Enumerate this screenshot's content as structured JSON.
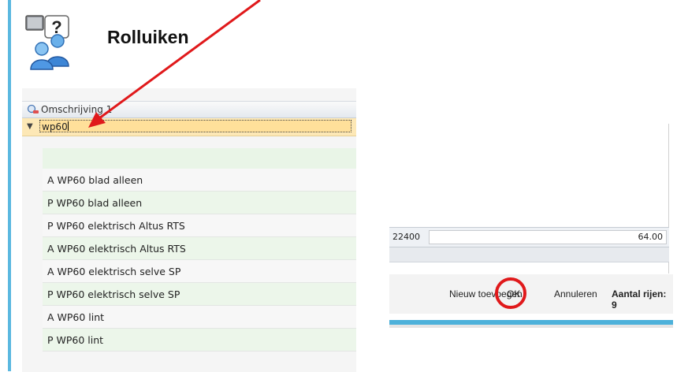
{
  "header": {
    "title": "Rolluiken",
    "icon": "people-help-icon"
  },
  "grid": {
    "column_header": "Omschrijving 1",
    "filter_value": "wp60",
    "items": [
      "A WP60 blad alleen",
      "P WP60 blad alleen",
      "P WP60 elektrisch Altus RTS",
      "A WP60 elektrisch Altus RTS",
      "A WP60 elektrisch selve SP",
      "P WP60 elektrisch selve SP",
      "A WP60 lint",
      "P WP60 lint"
    ]
  },
  "detail": {
    "code": "22400",
    "amount": "64.00"
  },
  "footer": {
    "new_label": "Nieuw toevoegen",
    "ok_label": "OK",
    "cancel_label": "Annuleren",
    "row_count_label": "Aantal rijen: 9"
  },
  "colors": {
    "accent": "#5bb8e0",
    "annotation": "#e0191b",
    "filter_row": "#fde8b6",
    "alt_row": "#ecf6ea"
  }
}
